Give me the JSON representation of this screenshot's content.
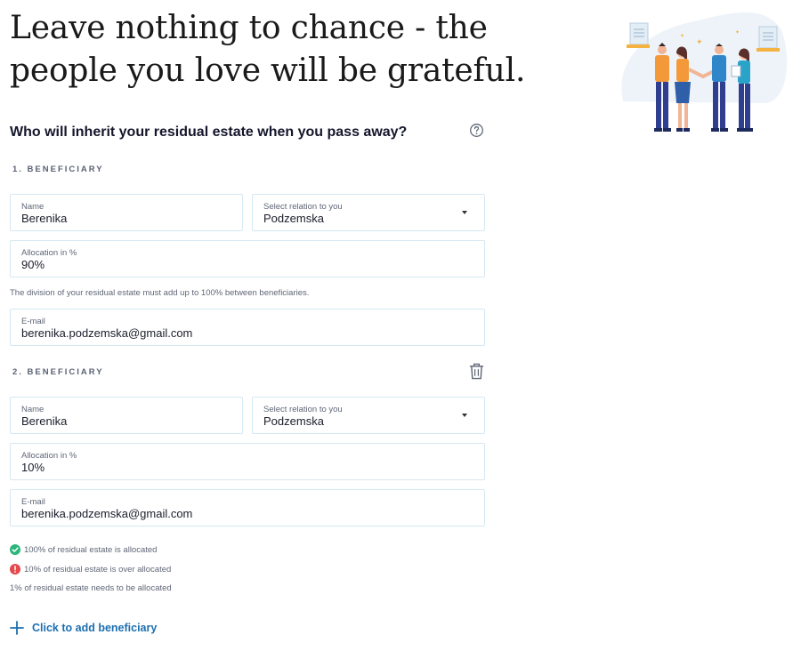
{
  "headline": "Leave nothing to chance - the people you love will be grateful.",
  "question": "Who will inherit your residual estate when you pass away?",
  "icons": {
    "help": "question-circle-icon",
    "delete": "trash-icon",
    "success": "check-circle-icon",
    "error": "exclamation-circle-icon",
    "add": "plus-icon"
  },
  "colors": {
    "accent": "#1c6fb0",
    "success": "#2bb57a",
    "error": "#e5484d",
    "field_border": "#d6e8f2"
  },
  "beneficiaries": [
    {
      "section_label": "1. BENEFICIARY",
      "name_label": "Name",
      "name_value": "Berenika",
      "relation_label": "Select relation to you",
      "relation_value": "Podzemska",
      "allocation_label": "Allocation in %",
      "allocation_value": "90%",
      "email_label": "E-mail",
      "email_value": "berenika.podzemska@gmail.com"
    },
    {
      "section_label": "2. BENEFICIARY",
      "name_label": "Name",
      "name_value": "Berenika",
      "relation_label": "Select relation to you",
      "relation_value": "Podzemska",
      "allocation_label": "Allocation in %",
      "allocation_value": "10%",
      "email_label": "E-mail",
      "email_value": "berenika.podzemska@gmail.com"
    }
  ],
  "allocation_hint": "The division of your residual estate must add up to 100% between beneficiaries.",
  "status": {
    "allocated": "100% of residual estate is allocated",
    "over_allocated": "10% of residual estate is over allocated",
    "needs_allocation": "1% of residual estate needs to be allocated"
  },
  "add_beneficiary_label": "Click to add beneficiary"
}
